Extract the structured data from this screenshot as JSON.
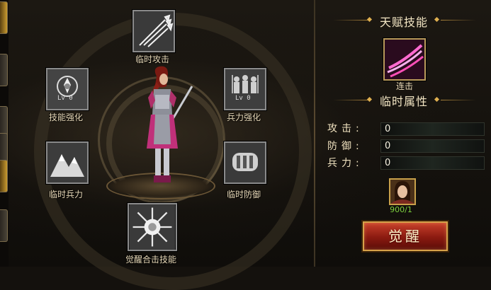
{
  "left_tabs": [
    {
      "name": "tab-1",
      "active": true
    },
    {
      "name": "tab-2",
      "active": false
    },
    {
      "name": "tab-3",
      "active": false
    },
    {
      "name": "tab-4",
      "active": false
    },
    {
      "name": "tab-5",
      "active": true
    },
    {
      "name": "tab-6",
      "active": false
    }
  ],
  "skills": {
    "temp_attack": {
      "label": "临时攻击",
      "icon": "spear-icon"
    },
    "skill_enhance": {
      "label": "技能强化",
      "icon": "emblem-icon",
      "level": "Lv 0"
    },
    "troop_enhance": {
      "label": "兵力强化",
      "icon": "soldiers-icon",
      "level": "Lv 0"
    },
    "temp_troops": {
      "label": "临时兵力",
      "icon": "mountain-icon"
    },
    "temp_defense": {
      "label": "临时防御",
      "icon": "shield-icon"
    },
    "awaken_combo": {
      "label": "觉醒合击技能",
      "icon": "star-burst-icon"
    }
  },
  "right_panel": {
    "talent_title": "天赋技能",
    "talent_skill": {
      "name": "连击",
      "icon": "slash-icon"
    },
    "attr_title": "临时属性",
    "attributes": [
      {
        "label": "攻击:",
        "value": "0"
      },
      {
        "label": "防御:",
        "value": "0"
      },
      {
        "label": "兵力:",
        "value": "0"
      }
    ],
    "hero_count": "900/1",
    "awaken_button": "觉醒"
  },
  "colors": {
    "accent_gold": "#d6a24a",
    "button_red": "#8a1a10",
    "count_green": "#7ed23e"
  }
}
